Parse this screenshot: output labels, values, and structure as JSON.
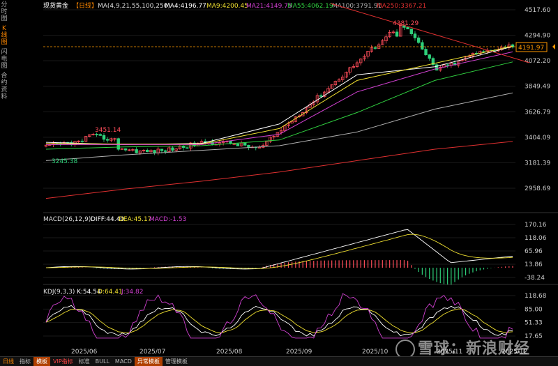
{
  "sidebar": {
    "items": [
      "分时图",
      "K线图",
      "闪电图",
      "合约资料"
    ],
    "active_index": 1
  },
  "header": {
    "symbol": "现货黄金",
    "period": "【日线】",
    "ma_label": "MA(4,9,21,55,100,250)",
    "ma4": "MA4:4196.77",
    "ma9": "MA9:4200.45",
    "ma21": "MA21:4149.75",
    "ma55": "MA55:4062.19",
    "ma100": "MA100:3791.91",
    "ma250": "MA250:3367.21"
  },
  "macd_header": {
    "name": "MACD(26,12,9)",
    "diff": "DIFF:44.40",
    "dea": "DEA:45.17",
    "macd": "MACD:-1.53"
  },
  "kdj_header": {
    "name": "KDJ(9,3,3)",
    "k": "K:54.54",
    "d": "D:64.41",
    "j": "J:34.82"
  },
  "price_axis": [
    "4517.60",
    "4294.90",
    "4072.20",
    "3849.49",
    "3626.79",
    "3404.09",
    "3181.39",
    "2958.69"
  ],
  "macd_axis": [
    "170.16",
    "118.06",
    "65.96",
    "13.86",
    "-38.24"
  ],
  "kdj_axis": [
    "118.68",
    "85.00",
    "51.33",
    "17.65"
  ],
  "x_labels": [
    "2025/06",
    "2025/07",
    "2025/08",
    "2025/09",
    "2025/10",
    "2025/11",
    "2025/12"
  ],
  "annotations": {
    "high": "4381.29",
    "mid_high": "3451.14",
    "low": "3245.38",
    "current_price": "4191.97"
  },
  "bottom_bar": [
    "日线",
    "指标",
    "模板",
    "VIP指标",
    "标准",
    "BULL",
    "MACD",
    "异常模板",
    "管理模板"
  ],
  "watermark": "雪球：新浪财经",
  "colors": {
    "up": "#ff4d5a",
    "down": "#2ed17a",
    "ma4": "#ffffff",
    "ma9": "#f0e030",
    "ma21": "#d040d0",
    "ma55": "#30d040",
    "ma100": "#b0b0b0",
    "ma250": "#e03030"
  },
  "chart_data": {
    "type": "line",
    "title": "现货黄金【日线】",
    "x": [
      "2025/06",
      "2025/07",
      "2025/08",
      "2025/09",
      "2025/10",
      "2025/11",
      "2025/12"
    ],
    "series": [
      {
        "name": "MA4",
        "values": [
          3360,
          3340,
          3350,
          3520,
          3950,
          4020,
          4196.77
        ]
      },
      {
        "name": "MA9",
        "values": [
          3350,
          3345,
          3345,
          3480,
          3900,
          4050,
          4200.45
        ]
      },
      {
        "name": "MA21",
        "values": [
          3340,
          3340,
          3340,
          3430,
          3800,
          4000,
          4149.75
        ]
      },
      {
        "name": "MA55",
        "values": [
          3300,
          3320,
          3330,
          3380,
          3620,
          3900,
          4062.19
        ]
      },
      {
        "name": "MA100",
        "values": [
          3200,
          3250,
          3290,
          3330,
          3450,
          3650,
          3791.91
        ]
      },
      {
        "name": "MA250",
        "values": [
          2870,
          2950,
          3020,
          3100,
          3200,
          3300,
          3367.21
        ]
      }
    ],
    "ylim": [
      2958.69,
      4517.6
    ],
    "macd": {
      "diff": 44.4,
      "dea": 45.17,
      "macd": -1.53,
      "ylim": [
        -38.24,
        170.16
      ]
    },
    "kdj": {
      "k": 54.54,
      "d": 64.41,
      "j": 34.82,
      "ylim": [
        17.65,
        118.68
      ]
    }
  }
}
